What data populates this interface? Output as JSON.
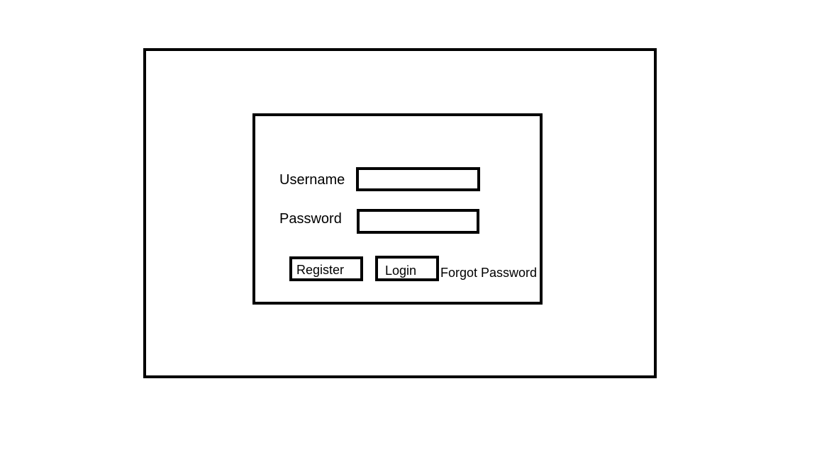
{
  "login_form": {
    "username_label": "Username",
    "password_label": "Password",
    "username_value": "",
    "password_value": "",
    "register_label": "Register",
    "login_label": "Login",
    "forgot_password_label": "Forgot Password"
  },
  "colors": {
    "background": "#ffffff",
    "line": "#000000"
  }
}
